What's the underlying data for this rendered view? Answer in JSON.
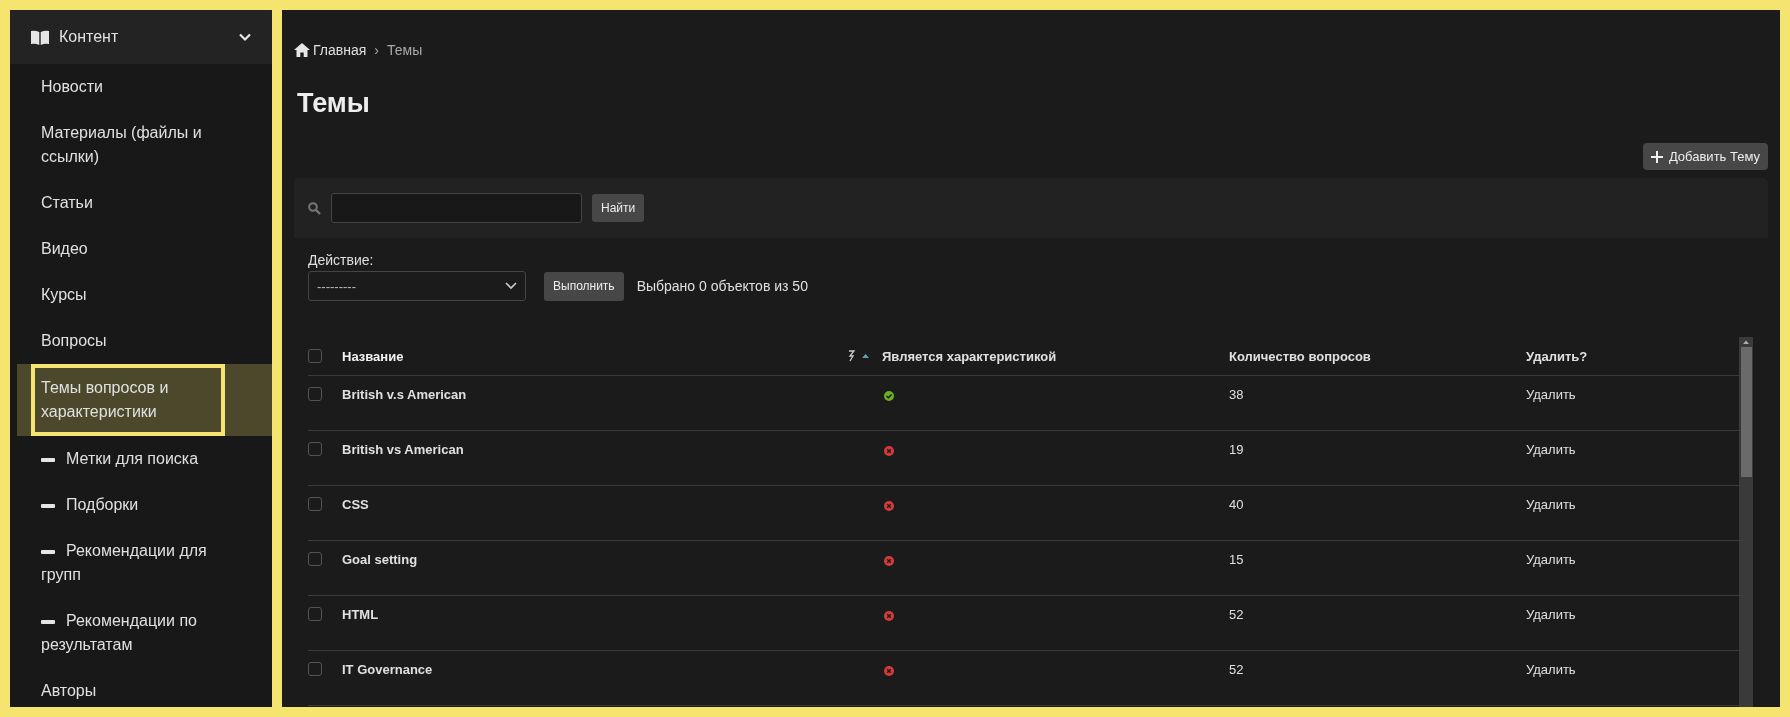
{
  "sidebar": {
    "section": {
      "title": "Контент",
      "expanded": true
    },
    "items": [
      {
        "label": "Новости",
        "kind": "page",
        "selected": false
      },
      {
        "label": "Материалы (файлы и ссылки)",
        "kind": "page",
        "selected": false
      },
      {
        "label": "Статьи",
        "kind": "page",
        "selected": false
      },
      {
        "label": "Видео",
        "kind": "page",
        "selected": false
      },
      {
        "label": "Курсы",
        "kind": "page",
        "selected": false
      },
      {
        "label": "Вопросы",
        "kind": "page",
        "selected": false
      },
      {
        "label": "Темы вопросов и характеристики",
        "kind": "page",
        "selected": true
      },
      {
        "label": "Метки для поиска",
        "kind": "sub",
        "selected": false
      },
      {
        "label": "Подборки",
        "kind": "sub",
        "selected": false
      },
      {
        "label": "Рекомендации для групп",
        "kind": "sub",
        "selected": false
      },
      {
        "label": "Рекомендации по результатам",
        "kind": "sub",
        "selected": false
      },
      {
        "label": "Авторы",
        "kind": "page",
        "selected": false
      }
    ]
  },
  "breadcrumb": [
    {
      "label": "Главная",
      "kind": "home"
    },
    {
      "label": "›",
      "kind": "separator"
    },
    {
      "label": "Темы",
      "kind": "current"
    }
  ],
  "title": "Темы",
  "add_button": "Добавить Тему",
  "search": {
    "button": "Найти"
  },
  "action": {
    "label": "Действие:",
    "value": "---------",
    "button": "Выполнить",
    "status": "Выбрано 0 объектов из 50"
  },
  "table": {
    "all_checked": false,
    "columns": [
      {
        "label": "Название",
        "sorted": true
      },
      {
        "label": "Является характеристикой",
        "sorted": false
      },
      {
        "label": "Количество вопросов",
        "sorted": false
      },
      {
        "label": "Удалить?",
        "sorted": false
      }
    ],
    "rows": [
      {
        "name": "British v.s American",
        "is_characteristic": true,
        "count": "38",
        "delete": "Удалить",
        "checked": false
      },
      {
        "name": "British vs American",
        "is_characteristic": false,
        "count": "19",
        "delete": "Удалить",
        "checked": false
      },
      {
        "name": "CSS",
        "is_characteristic": false,
        "count": "40",
        "delete": "Удалить",
        "checked": false
      },
      {
        "name": "Goal setting",
        "is_characteristic": false,
        "count": "15",
        "delete": "Удалить",
        "checked": false
      },
      {
        "name": "HTML",
        "is_characteristic": false,
        "count": "52",
        "delete": "Удалить",
        "checked": false
      },
      {
        "name": "IT Governance",
        "is_characteristic": false,
        "count": "52",
        "delete": "Удалить",
        "checked": false
      }
    ]
  }
}
